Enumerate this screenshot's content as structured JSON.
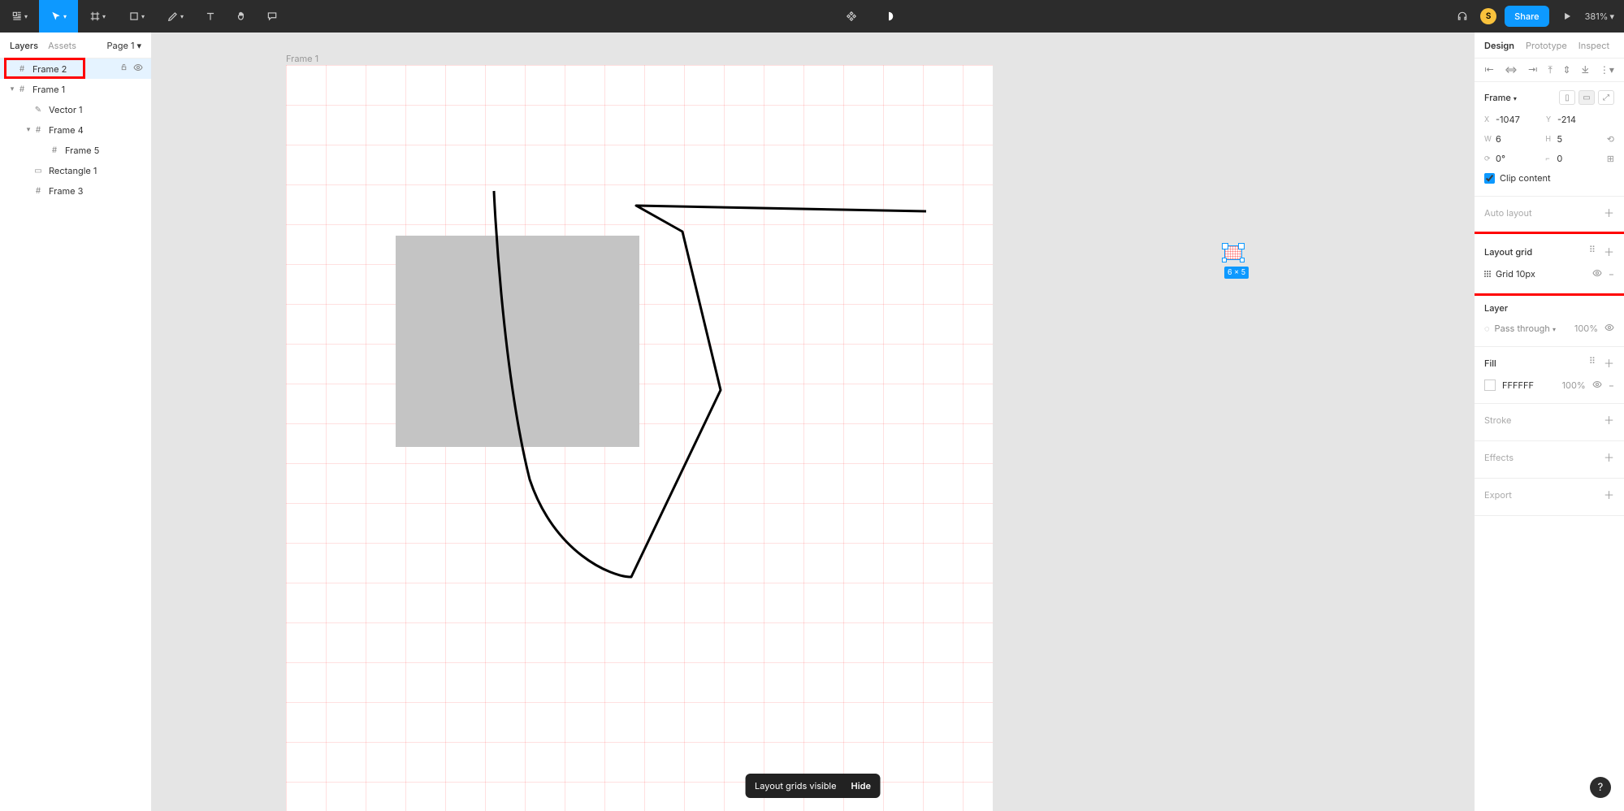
{
  "toolbar": {
    "zoom": "381%",
    "share_label": "Share",
    "avatar_initial": "S"
  },
  "left_panel": {
    "tabs": {
      "layers": "Layers",
      "assets": "Assets"
    },
    "page_label": "Page 1",
    "layers": [
      {
        "name": "Frame 2",
        "icon": "frame",
        "depth": 1,
        "selected": true,
        "locked": false,
        "show_controls": true
      },
      {
        "name": "Frame 1",
        "icon": "frame",
        "depth": 1,
        "selected": false,
        "expandable": true,
        "expanded": true
      },
      {
        "name": "Vector 1",
        "icon": "vector",
        "depth": 2,
        "selected": false
      },
      {
        "name": "Frame 4",
        "icon": "frame",
        "depth": 2,
        "selected": false,
        "expandable": true,
        "expanded": true
      },
      {
        "name": "Frame 5",
        "icon": "frame",
        "depth": 3,
        "selected": false
      },
      {
        "name": "Rectangle 1",
        "icon": "rect",
        "depth": 2,
        "selected": false
      },
      {
        "name": "Frame 3",
        "icon": "frame",
        "depth": 2,
        "selected": false
      }
    ]
  },
  "canvas": {
    "frame1_label": "Frame 1",
    "dim_badge": "6 × 5",
    "toast_message": "Layout grids visible",
    "toast_action": "Hide"
  },
  "right_panel": {
    "tabs": {
      "design": "Design",
      "prototype": "Prototype",
      "inspect": "Inspect"
    },
    "frame": {
      "title": "Frame",
      "x": "-1047",
      "y": "-214",
      "w": "6",
      "h": "5",
      "rotation": "0°",
      "corner": "0",
      "clip_label": "Clip content",
      "clip_checked": true
    },
    "auto_layout": {
      "title": "Auto layout"
    },
    "layout_grid": {
      "title": "Layout grid",
      "item": "Grid 10px"
    },
    "layer": {
      "title": "Layer",
      "blend": "Pass through",
      "opacity": "100%"
    },
    "fill": {
      "title": "Fill",
      "hex": "FFFFFF",
      "opacity": "100%"
    },
    "stroke": {
      "title": "Stroke"
    },
    "effects": {
      "title": "Effects"
    },
    "export_e": {
      "title": "Export"
    }
  }
}
